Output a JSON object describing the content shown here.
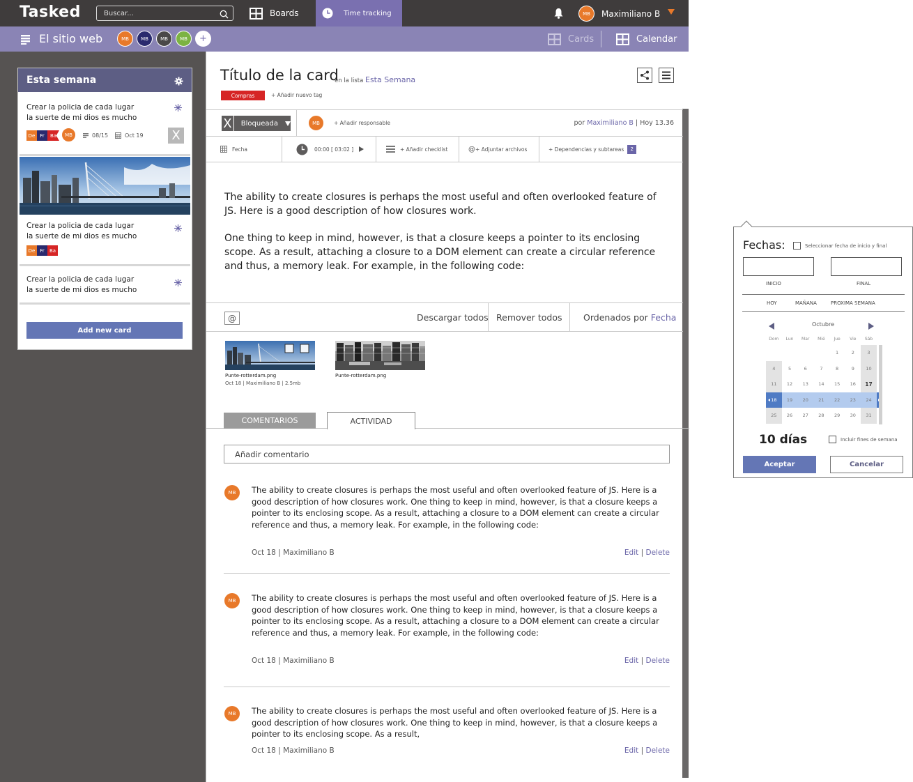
{
  "app": {
    "logo": "Tasked"
  },
  "topbar": {
    "search_placeholder": "Buscar...",
    "boards_label": "Boards",
    "time_tracking_label": "Time tracking",
    "user_initials": "MB",
    "user_name": "Maximiliano B"
  },
  "boardbar": {
    "title": "El sitio web",
    "members": [
      "MB",
      "MB",
      "MB",
      "MB"
    ],
    "add_member": "+",
    "view_cards": "Cards",
    "view_calendar": "Calendar"
  },
  "list": {
    "title": "Esta semana",
    "cards": [
      {
        "line1": "Crear la policia de cada lugar",
        "line2": "la suerte de mi dios es mucho",
        "tags": [
          "De",
          "Fr",
          "Ba"
        ],
        "assignee": "MB",
        "checklist": "08/15",
        "date": "Oct 19",
        "blocked": "X"
      },
      {
        "line1": "Crear la policia de cada lugar",
        "line2": "la suerte de mi dios es mucho",
        "tags": [
          "De",
          "Fr",
          "Ba"
        ]
      },
      {
        "line1": "Crear la policia de cada lugar",
        "line2": "la suerte de mi dios es mucho"
      }
    ],
    "add_card": "Add new card"
  },
  "detail": {
    "title": "Título de la card",
    "in_list_prefix": "en la lista",
    "in_list_name": "Esta Semana",
    "tag": "Compras",
    "add_tag": "+ Añadir nuevo tag",
    "status_x": "X",
    "status": "Bloqueada",
    "assignee": "MB",
    "add_responsible": "+ Añadir responsable",
    "by_prefix": "por",
    "by_user": "Maximiliano B",
    "by_time": "Hoy 13.36",
    "fecha": "Fecha",
    "timer": "00:00 [ 03:02 ]",
    "add_checklist": "+ Añadir checklist",
    "attach": "+ Adjuntar archivos",
    "dependencies": "+ Dependencias y subtareas",
    "dependencies_count": "2",
    "description_p1": "The ability to create closures is perhaps the most useful and often overlooked feature of JS. Here is a good description of how closures work.",
    "description_p2": "One thing to keep in mind, however, is that a closure keeps a pointer to its enclosing scope. As a result, attaching a closure to a DOM element can create a circular reference and thus, a memory leak. For example, in the following code:",
    "download_all": "Descargar todos",
    "remove_all": "Remover todos",
    "sorted_by_prefix": "Ordenados por",
    "sorted_by_field": "Fecha",
    "files": [
      {
        "name": "Punte-rotterdam.png",
        "meta": "Oct 18  |  Maximiliano B  |  2.5mb"
      },
      {
        "name": "Punte-rotterdam.png"
      }
    ],
    "tab_comments": "COMENTARIOS",
    "tab_activity": "ACTIVIDAD",
    "comment_placeholder": "Añadir comentario",
    "comments": [
      {
        "avatar": "MB",
        "text": "The ability to create closures is perhaps the most useful and often overlooked feature of JS. Here is a good description of how closures work. One thing to keep in mind, however, is that a closure keeps a pointer to its enclosing scope. As a result, attaching a closure to a DOM element can create a circular reference and thus, a memory leak. For example, in the following code:",
        "meta": "Oct 18  |  Maximiliano B",
        "edit": "Edit",
        "delete": "Delete"
      },
      {
        "avatar": "MB",
        "text": "The ability to create closures is perhaps the most useful and often overlooked feature of JS. Here is a good description of how closures work. One thing to keep in mind, however, is that a closure keeps a pointer to its enclosing scope. As a result, attaching a closure to a DOM element can create a circular reference and thus, a memory leak. For example, in the following code:",
        "meta": "Oct 18  |  Maximiliano B",
        "edit": "Edit",
        "delete": "Delete"
      },
      {
        "avatar": "MB",
        "text": "The ability to create closures is perhaps the most useful and often overlooked feature of JS. Here is a good description of how closures work. One thing to keep in mind, however, is that a closure keeps a pointer to its enclosing scope. As a result,",
        "meta": "Oct 18  |  Maximiliano B",
        "edit": "Edit",
        "delete": "Delete"
      }
    ]
  },
  "datepicker": {
    "title": "Fechas:",
    "range_check": "Seleccionar fecha de inicio y final",
    "start_label": "INICIO",
    "end_label": "FINAL",
    "quick": [
      "HOY",
      "MAÑANA",
      "PROXIMA SEMANA"
    ],
    "month": "Octubre",
    "weekdays": [
      "Dom",
      "Lun",
      "Mie",
      "Mié",
      "Jue",
      "Vie",
      "Sáb"
    ],
    "weekdays_display": [
      "Dom",
      "Lun",
      "Mar",
      "Mié",
      "Jue",
      "Vie",
      "Sáb"
    ],
    "weeks": [
      [
        "",
        "",
        "",
        "",
        "1",
        "2",
        "3"
      ],
      [
        "4",
        "5",
        "6",
        "7",
        "8",
        "9",
        "10"
      ],
      [
        "11",
        "12",
        "13",
        "14",
        "15",
        "16",
        "17"
      ],
      [
        "18",
        "19",
        "20",
        "21",
        "22",
        "23",
        "24"
      ],
      [
        "25",
        "26",
        "27",
        "28",
        "29",
        "30",
        "31"
      ]
    ],
    "today": "17",
    "selected_range": [
      "18",
      "24"
    ],
    "days_count": "10 días",
    "include_weekends": "Incluir fines de semana",
    "accept": "Aceptar",
    "cancel": "Cancelar"
  }
}
